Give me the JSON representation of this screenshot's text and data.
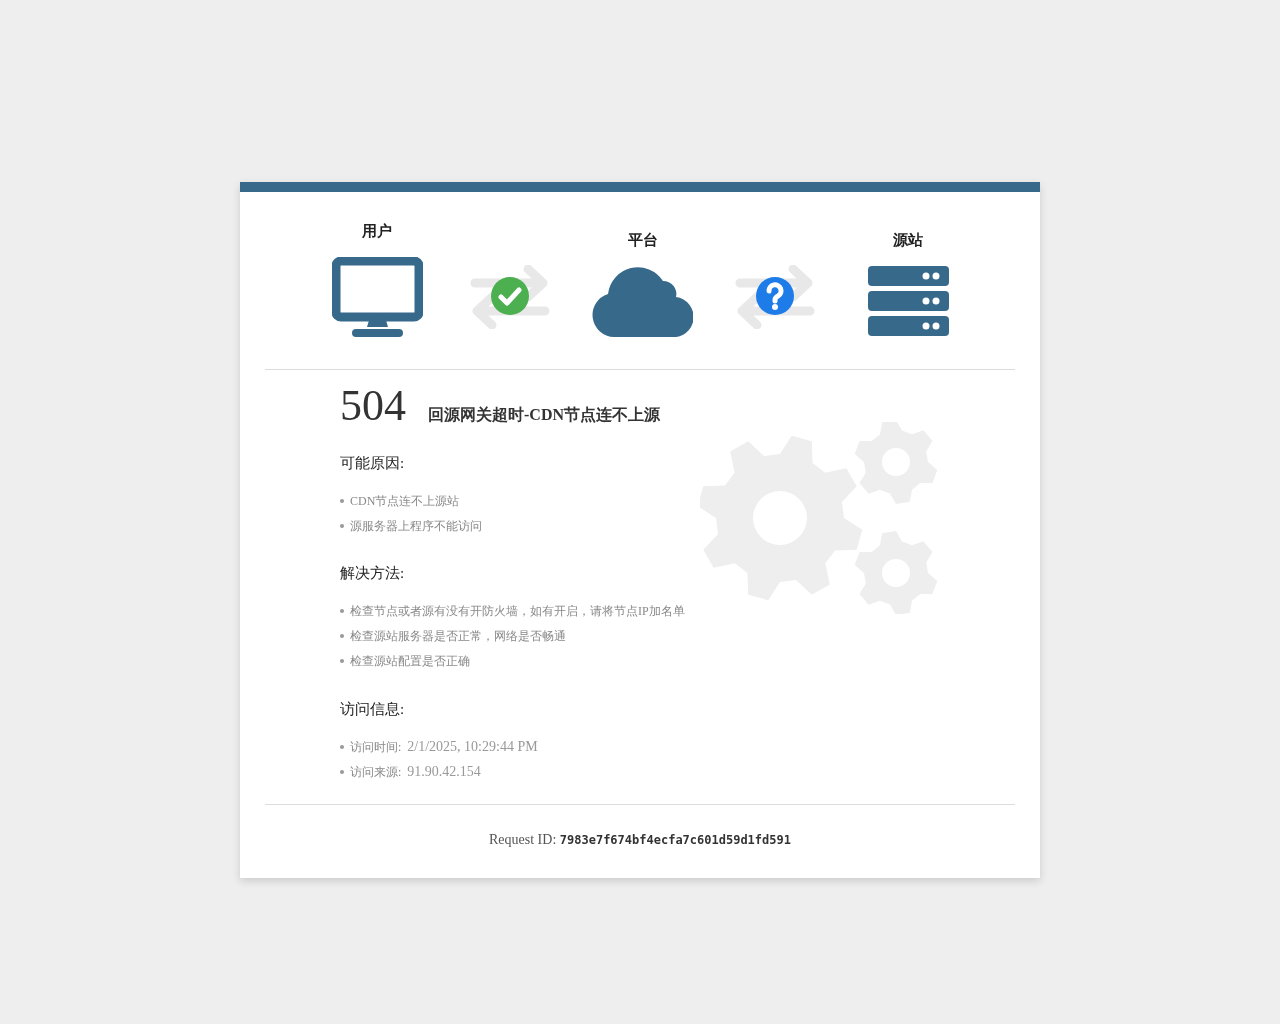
{
  "nodes": [
    {
      "label": "用户",
      "kind": "monitor"
    },
    {
      "label": "平台",
      "kind": "cloud"
    },
    {
      "label": "源站",
      "kind": "server"
    }
  ],
  "links": [
    {
      "kind": "ok"
    },
    {
      "kind": "unknown"
    }
  ],
  "error": {
    "code": "504",
    "title": "回源网关超时-CDN节点连不上源"
  },
  "sections": [
    {
      "heading": "可能原因:",
      "items": [
        {
          "text": "CDN节点连不上源站"
        },
        {
          "text": "源服务器上程序不能访问"
        }
      ]
    },
    {
      "heading": "解决方法:",
      "items": [
        {
          "text": "检查节点或者源有没有开防火墙，如有开启，请将节点IP加名单"
        },
        {
          "text": "检查源站服务器是否正常，网络是否畅通"
        },
        {
          "text": "检查源站配置是否正确"
        }
      ]
    },
    {
      "heading": "访问信息:",
      "items": [
        {
          "text": "访问时间:",
          "value": "2/1/2025, 10:29:44 PM"
        },
        {
          "text": "访问来源:",
          "value": "91.90.42.154"
        }
      ]
    }
  ],
  "request": {
    "label": "Request ID:",
    "value": "7983e7f674bf4ecfa7c601d59d1fd591"
  }
}
